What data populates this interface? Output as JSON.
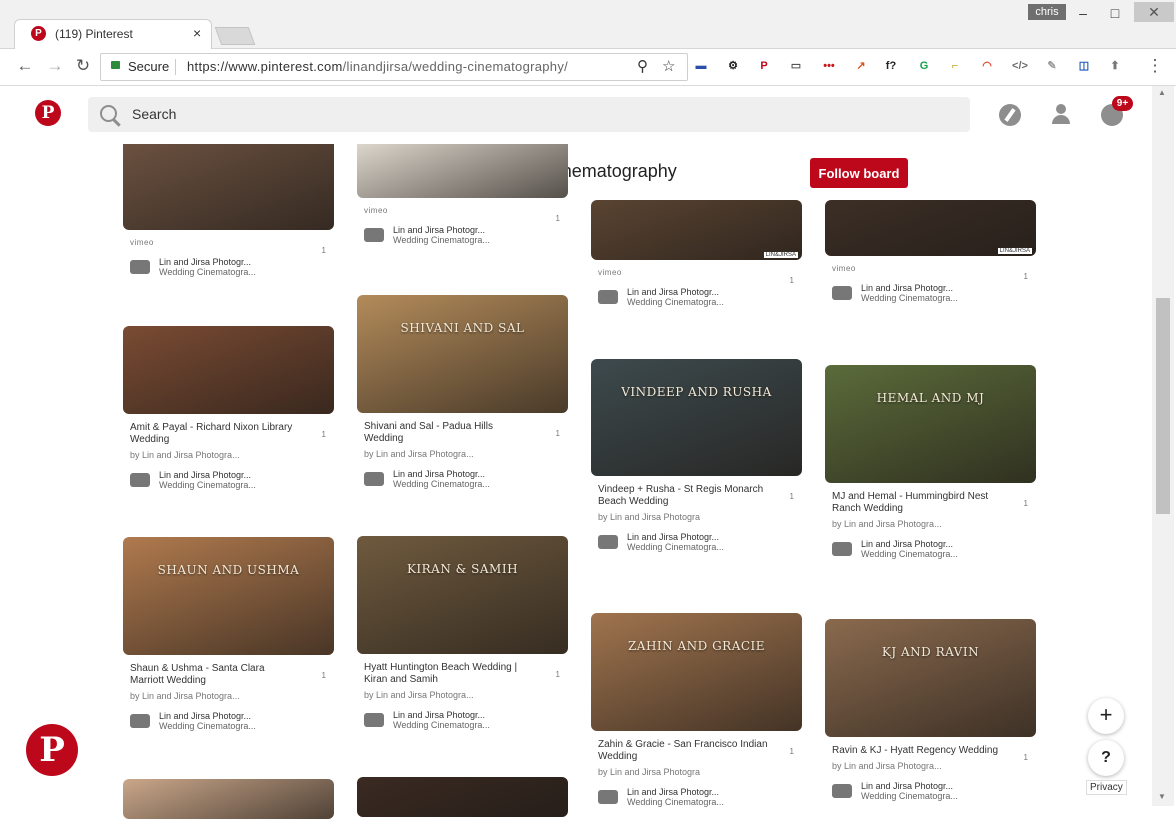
{
  "browser": {
    "tab_title": "(119) Pinterest",
    "tab_close": "×",
    "profile": "chris",
    "window_controls": {
      "minimize": "–",
      "maximize": "□",
      "close": "✕"
    },
    "nav": {
      "back": "←",
      "forward": "→",
      "reload": "↻"
    },
    "secure_label": "Secure",
    "url_host": "https://www.pinterest.com",
    "url_path": "/linandjirsa/wedding-cinematography/",
    "icons": [
      "search-icon",
      "star-icon"
    ],
    "extensions": [
      {
        "name": "flag-ext-icon",
        "glyph": "▬",
        "color": "#2b4fa8"
      },
      {
        "name": "gear-ext-icon",
        "glyph": "⚙",
        "color": "#222"
      },
      {
        "name": "pinterest-ext-icon",
        "glyph": "P",
        "color": "#bd081c"
      },
      {
        "name": "keyboard-ext-icon",
        "glyph": "▭",
        "color": "#555"
      },
      {
        "name": "lastpass-ext-icon",
        "glyph": "•••",
        "color": "#c4161c"
      },
      {
        "name": "chart-ext-icon",
        "glyph": "↗",
        "color": "#d9541e"
      },
      {
        "name": "formula-ext-icon",
        "glyph": "f?",
        "color": "#222"
      },
      {
        "name": "grammarly-ext-icon",
        "glyph": "G",
        "color": "#15a34a"
      },
      {
        "name": "bookmark-ext-icon",
        "glyph": "⌐",
        "color": "#c9a227"
      },
      {
        "name": "rainbow-ext-icon",
        "glyph": "◠",
        "color": "#e0452b"
      },
      {
        "name": "code-ext-icon",
        "glyph": "</>",
        "color": "#6b6b6b"
      },
      {
        "name": "edit-ext-icon",
        "glyph": "✎",
        "color": "#9a9a9a"
      },
      {
        "name": "outline-ext-icon",
        "glyph": "◫",
        "color": "#1b58b8"
      },
      {
        "name": "shield-ext-icon",
        "glyph": "⬆",
        "color": "#777"
      }
    ],
    "menu": "⋮"
  },
  "header": {
    "logo": "P",
    "search_placeholder": "Search",
    "notifications_badge": "9+"
  },
  "board": {
    "title": "Wedding Cinematography",
    "follow_label": "Follow board"
  },
  "pins": [
    {
      "source": "vimeo",
      "saves": "1",
      "saver": "Lin and Jirsa Photogr...",
      "board": "Wedding Cinematogra...",
      "color": "#6b5140"
    },
    {
      "source": "vimeo",
      "saves": "1",
      "saver": "Lin and Jirsa Photogr...",
      "board": "Wedding Cinematogra...",
      "color": "#ddd6cc"
    },
    {
      "source": "vimeo",
      "saves": "1",
      "saver": "Lin and Jirsa Photogr...",
      "board": "Wedding Cinematogra...",
      "color": "#5a4432",
      "watermark": "LIN&JIRSA"
    },
    {
      "source": "vimeo",
      "saves": "1",
      "saver": "Lin and Jirsa Photogr...",
      "board": "Wedding Cinematogra...",
      "color": "#3c2f26",
      "watermark": "LIN&JIRSA"
    },
    {
      "title": "Amit & Payal - Richard Nixon Library Wedding",
      "by": "by Lin and Jirsa Photogra...",
      "saves": "1",
      "saver": "Lin and Jirsa Photogr...",
      "board": "Wedding Cinematogra...",
      "color": "#7a4b33"
    },
    {
      "title": "Shivani and Sal - Padua Hills Wedding",
      "by": "by Lin and Jirsa Photogra...",
      "saves": "1",
      "saver": "Lin and Jirsa Photogr...",
      "board": "Wedding Cinematogra...",
      "color": "#b38b5a",
      "overlay": "SHIVANI AND SAL"
    },
    {
      "title": "Vindeep + Rusha - St Regis Monarch Beach Wedding",
      "by": "by Lin and Jirsa Photogra",
      "saves": "1",
      "saver": "Lin and Jirsa Photogr...",
      "board": "Wedding Cinematogra...",
      "color": "#3d4a4d",
      "overlay": "VINDEEP AND RUSHA"
    },
    {
      "title": "MJ and Hemal - Hummingbird Nest Ranch Wedding",
      "by": "by Lin and Jirsa Photogra...",
      "saves": "1",
      "saver": "Lin and Jirsa Photogr...",
      "board": "Wedding Cinematogra...",
      "color": "#5b6b3a",
      "overlay": "HEMAL AND MJ"
    },
    {
      "title": "Shaun & Ushma - Santa Clara Marriott Wedding",
      "by": "by Lin and Jirsa Photogra...",
      "saves": "1",
      "saver": "Lin and Jirsa Photogr...",
      "board": "Wedding Cinematogra...",
      "color": "#b07a4e",
      "overlay": "SHAUN AND USHMA"
    },
    {
      "title": "Hyatt Huntington Beach Wedding | Kiran and Samih",
      "by": "by Lin and Jirsa Photogra...",
      "saves": "1",
      "saver": "Lin and Jirsa Photogr...",
      "board": "Wedding Cinematogra...",
      "color": "#6f5a3e",
      "overlay": "KIRAN & SAMIH"
    },
    {
      "title": "Zahin & Gracie - San Francisco Indian Wedding",
      "by": "by Lin and Jirsa Photogra",
      "saves": "1",
      "saver": "Lin and Jirsa Photogr...",
      "board": "Wedding Cinematogra...",
      "color": "#a0744e",
      "overlay": "ZAHIN AND GRACIE"
    },
    {
      "title": "Ravin & KJ - Hyatt Regency Wedding",
      "by": "by Lin and Jirsa Photogra...",
      "saves": "1",
      "saver": "Lin and Jirsa Photogr...",
      "board": "Wedding Cinematogra...",
      "color": "#8a6a4e",
      "overlay": "KJ AND RAVIN"
    },
    {
      "color": "#caa78a"
    },
    {
      "color": "#3a2a22"
    }
  ],
  "fab": {
    "add": "+",
    "help": "?",
    "privacy": "Privacy"
  },
  "big_logo": "P"
}
